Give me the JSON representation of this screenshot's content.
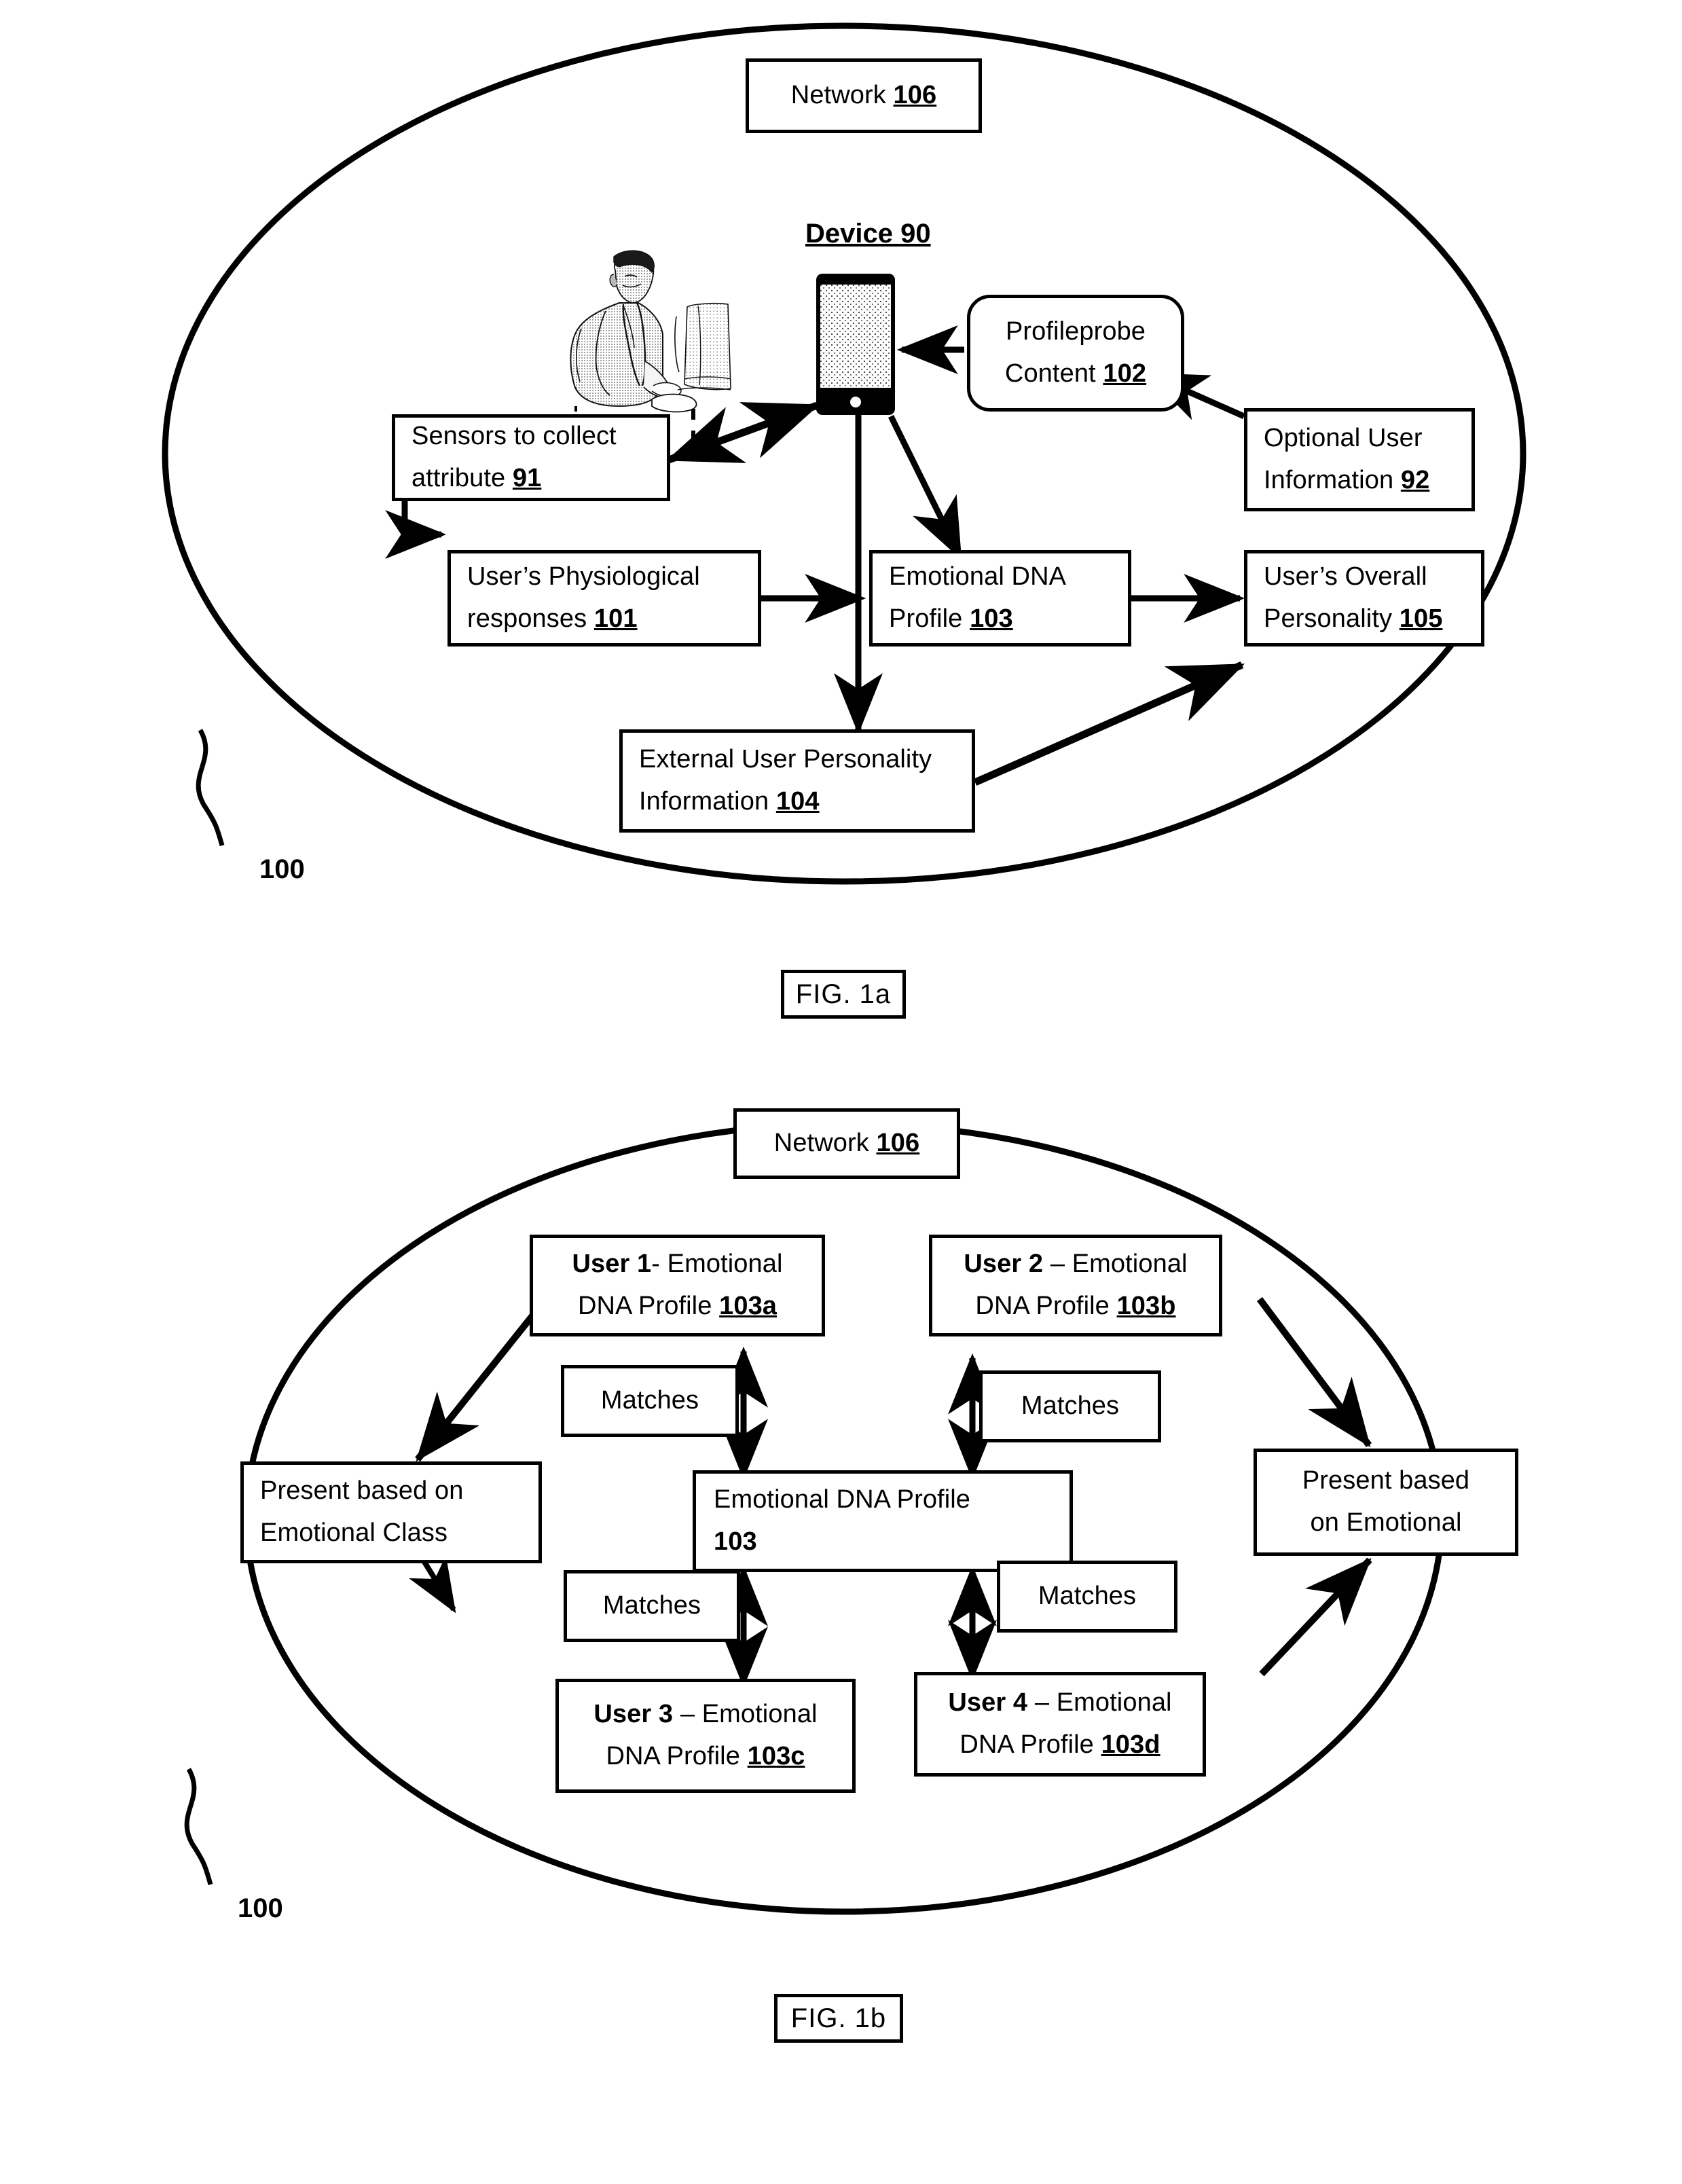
{
  "figures": [
    {
      "id": "fig1a",
      "caption": "FIG. 1a",
      "system_ref": "100",
      "device_label": "Device 90",
      "nodes": {
        "network": {
          "text": "Network ",
          "num": "106"
        },
        "profileprobe": {
          "line1": "Profileprobe",
          "line2_text": "Content ",
          "line2_num": "102"
        },
        "optional_user": {
          "line1": "Optional User",
          "line2_text": "Information ",
          "line2_num": "92"
        },
        "sensors": {
          "line1": "Sensors to collect",
          "line2_text": "attribute ",
          "line2_num": "91"
        },
        "physiological": {
          "line1": "User’s Physiological",
          "line2_text": "responses ",
          "line2_num": "101"
        },
        "emotional_dna": {
          "line1": "Emotional DNA",
          "line2_text": "Profile ",
          "line2_num": "103"
        },
        "overall_personality": {
          "line1": "User’s Overall",
          "line2_text": "Personality ",
          "line2_num": "105"
        },
        "external_personality": {
          "line1": "External User Personality",
          "line2_text": "Information ",
          "line2_num": "104"
        }
      },
      "icons": {
        "user_illustration": "person-at-computer-illustration",
        "device": "smartphone-icon"
      }
    },
    {
      "id": "fig1b",
      "caption": "FIG. 1b",
      "system_ref": "100",
      "nodes": {
        "network": {
          "text": "Network ",
          "num": "106"
        },
        "user1": {
          "who": "User 1",
          "sep": "- Emotional",
          "line2_text": "DNA Profile ",
          "line2_num": "103a"
        },
        "user2": {
          "who": "User 2",
          "sep": " – Emotional",
          "line2_text": "DNA Profile ",
          "line2_num": "103b"
        },
        "user3": {
          "who": "User 3",
          "sep": " – Emotional",
          "line2_text": "DNA Profile ",
          "line2_num": "103c"
        },
        "user4": {
          "who": "User 4",
          "sep": " – Emotional",
          "line2_text": "DNA Profile ",
          "line2_num": "103d"
        },
        "center": {
          "line1": "Emotional DNA Profile",
          "line2_num": "103"
        },
        "present_left": {
          "line1": "Present based on",
          "line2": "Emotional Class"
        },
        "present_right": {
          "line1": "Present based",
          "line2": "on Emotional"
        },
        "matches_tl": {
          "text": "Matches"
        },
        "matches_tr": {
          "text": "Matches"
        },
        "matches_bl": {
          "text": "Matches"
        },
        "matches_br": {
          "text": "Matches"
        }
      }
    }
  ]
}
